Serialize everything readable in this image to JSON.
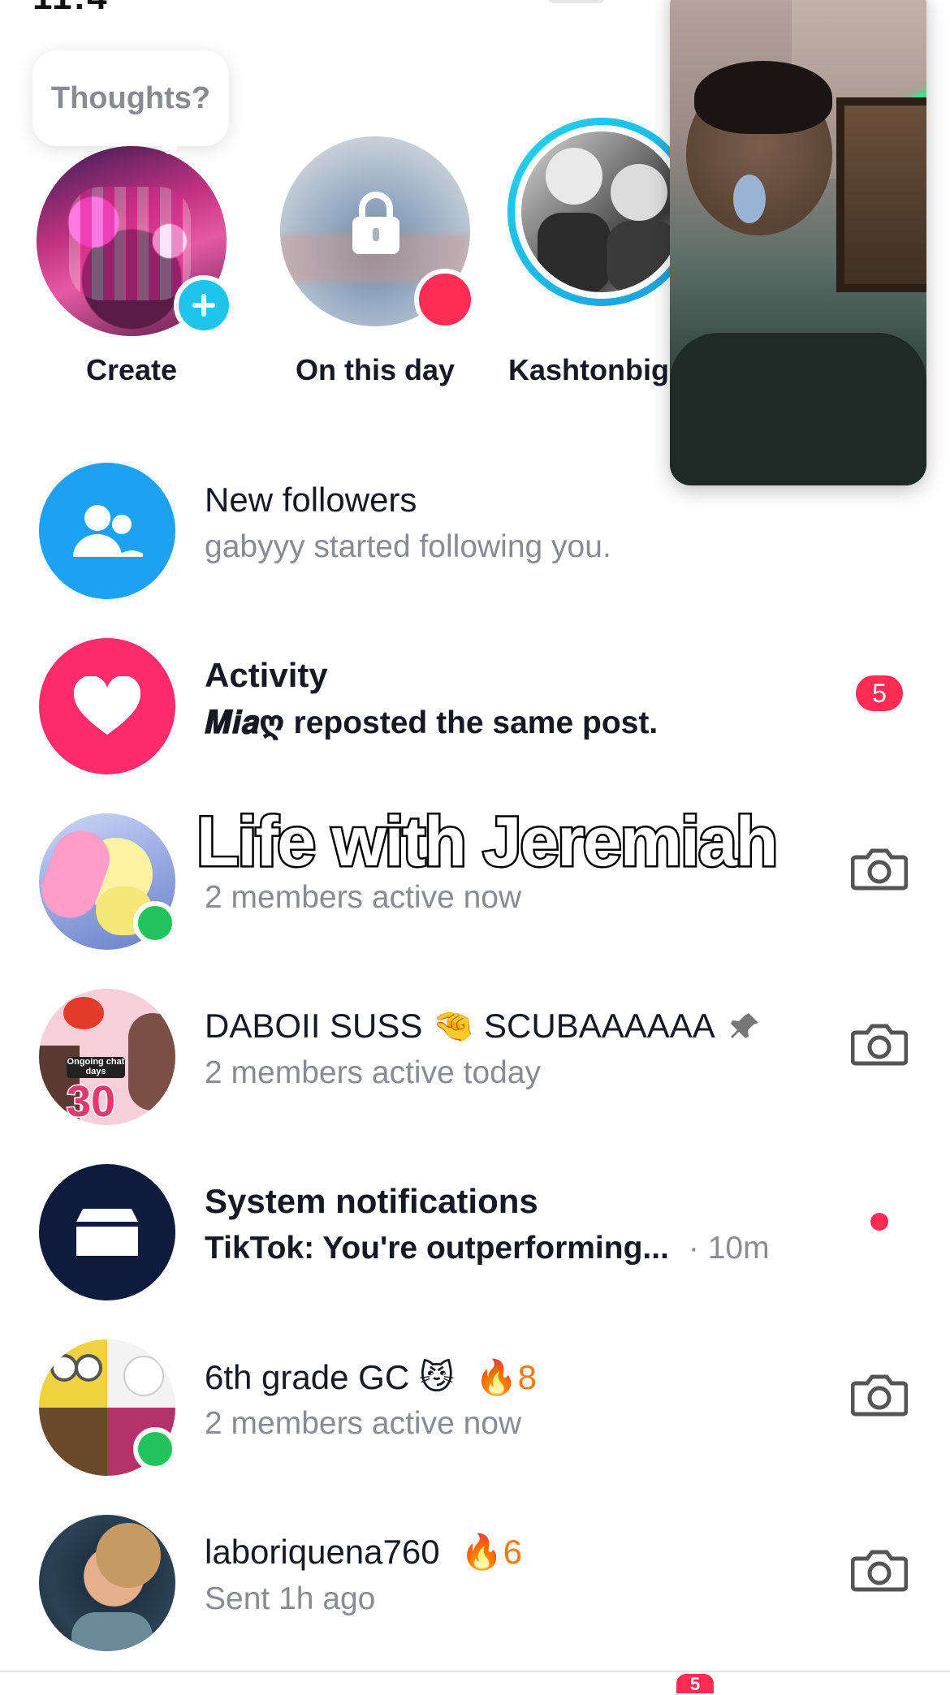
{
  "status": {
    "fragment": "11:4"
  },
  "stories": {
    "thoughts_prompt": "Thoughts?",
    "items": [
      {
        "label": "Create"
      },
      {
        "label": "On this day"
      },
      {
        "label": "Kashtonbigi"
      }
    ]
  },
  "overlay": {
    "caption": "Life with Jeremiah"
  },
  "rows": [
    {
      "title": "New followers",
      "subtitle": "gabyyy started following you."
    },
    {
      "title": "Activity",
      "subtitle_name": "𝑴𝒊𝒂ღ",
      "subtitle": " reposted the same post.",
      "badge": "5"
    },
    {
      "title": "",
      "subtitle": "2 members active now"
    },
    {
      "title": "DABOII SUSS 🤏 SCUBAAAAAA",
      "subtitle": "2 members active today"
    },
    {
      "title": "System notifications",
      "subtitle": "TikTok: You're outperforming...",
      "time": "· 10m"
    },
    {
      "title": "6th grade GC 😼",
      "streak": "8",
      "subtitle": "2 members active now"
    },
    {
      "title": "laboriquena760",
      "streak": "6",
      "subtitle": "Sent 1h ago"
    }
  ],
  "avatars": {
    "group_chat_badge_text": "Ongoing chat days",
    "group_chat_days": "30"
  },
  "colors": {
    "accent_blue": "#20d5ec",
    "red": "#fe2c55",
    "online": "#21c35a",
    "navy": "#0f1b3d",
    "fire": "#ff7a00"
  },
  "icons": [
    "plus-icon",
    "lock-icon",
    "people-icon",
    "heart-icon",
    "camera-icon",
    "inbox-icon",
    "pin-icon",
    "fire-icon"
  ],
  "nav": {
    "badge": "5"
  }
}
